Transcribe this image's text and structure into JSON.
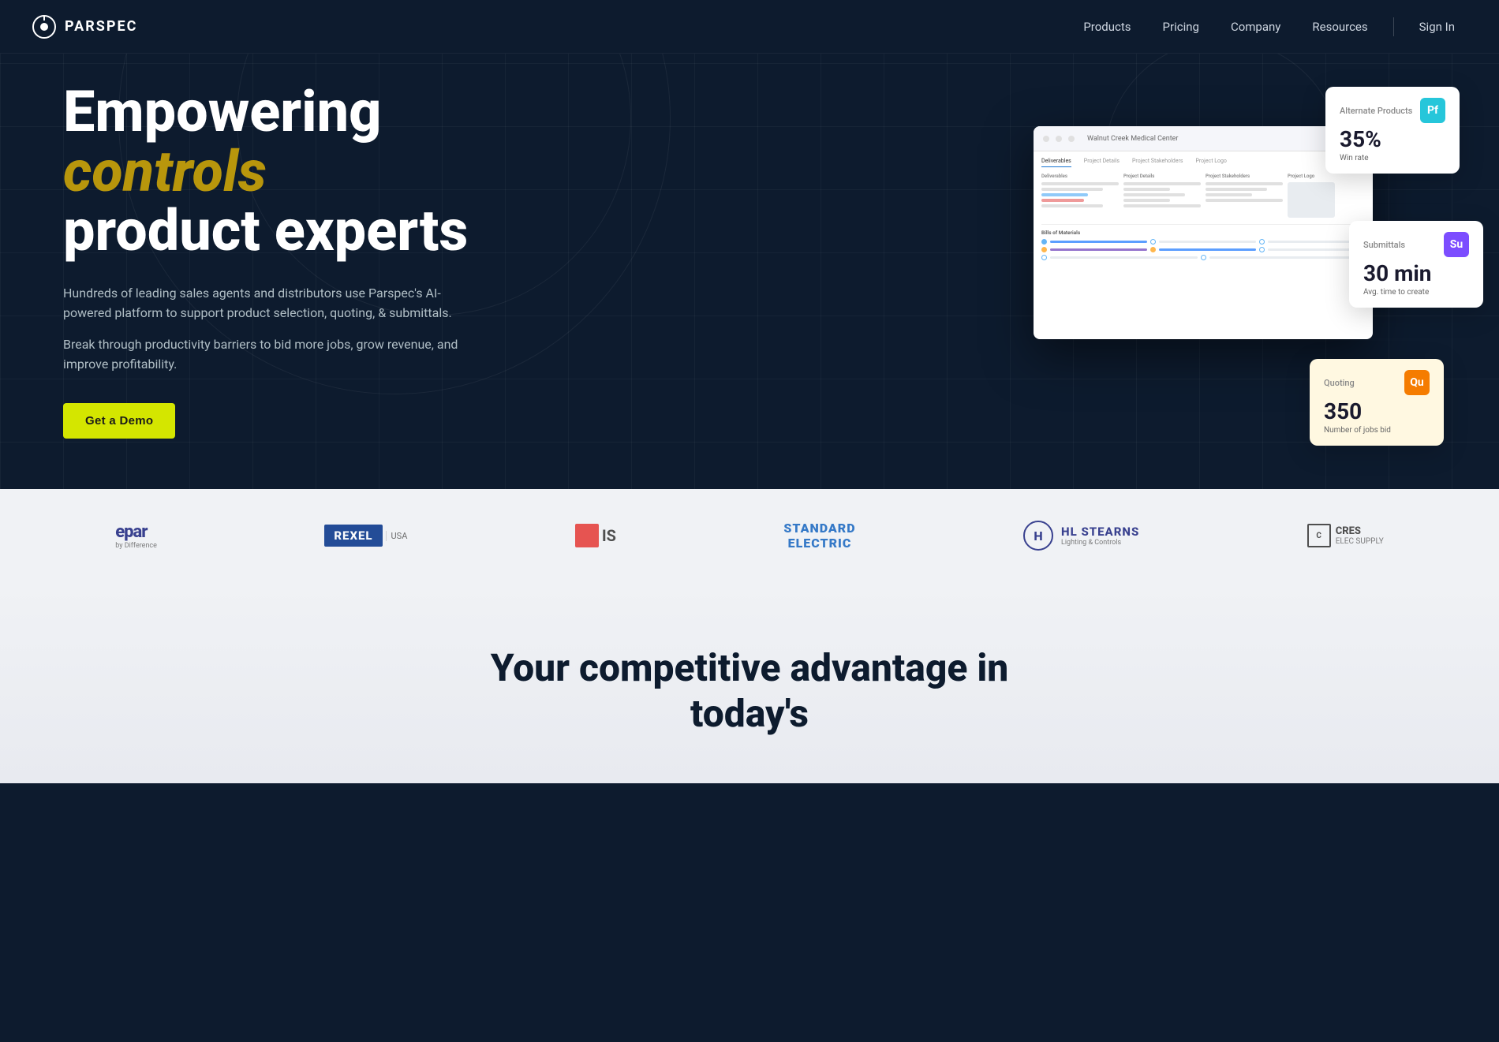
{
  "nav": {
    "logo_text": "PARSPEC",
    "links": [
      {
        "id": "products",
        "label": "Products"
      },
      {
        "id": "pricing",
        "label": "Pricing"
      },
      {
        "id": "company",
        "label": "Company"
      },
      {
        "id": "resources",
        "label": "Resources"
      }
    ],
    "signin_label": "Sign In"
  },
  "hero": {
    "title_line1": "Empowering",
    "title_highlight": "controls",
    "title_line2": "product experts",
    "desc1": "Hundreds of leading sales agents and distributors use Parspec's AI-powered platform to support product selection, quoting, & submittals.",
    "desc2": "Break through productivity barriers to bid more jobs, grow revenue, and improve profitability.",
    "cta_label": "Get a Demo"
  },
  "dashboard": {
    "project_name": "Walnut Creek Medical Center",
    "tabs": [
      "Deliverables",
      "Project Details",
      "Project Stakeholders",
      "Project Logo"
    ],
    "bom_label": "Bills of Materials"
  },
  "stat_cards": {
    "alternate_products": {
      "label": "Alternate Products",
      "value": "35%",
      "sub": "Win rate",
      "icon_text": "Pf",
      "icon_color": "#26c6da"
    },
    "submittals": {
      "label": "Submittals",
      "value": "30 min",
      "sub": "Avg. time to create",
      "icon_text": "Su",
      "icon_color": "#7c4dff"
    },
    "quoting": {
      "label": "Quoting",
      "value": "350",
      "sub": "Number of jobs bid",
      "icon_text": "Qu",
      "icon_color": "#f57c00"
    }
  },
  "logo_strip": {
    "logos": [
      {
        "id": "epar",
        "text": "epar",
        "subtext": "by Difference"
      },
      {
        "id": "rexel",
        "text": "REXEL",
        "subtext": "| USA"
      },
      {
        "id": "is",
        "text": "IS"
      },
      {
        "id": "standard",
        "text": "STANDARD ELECTRIC"
      },
      {
        "id": "hl-stearns",
        "text": "HL STEARNS",
        "subtext": "Lighting & Controls"
      },
      {
        "id": "cres",
        "text": "CRES ELEC SUPPLY"
      }
    ]
  },
  "bottom": {
    "title": "Your competitive advantage in today's"
  },
  "colors": {
    "hero_bg": "#0d1b2e",
    "accent_yellow": "#d4e600",
    "accent_gold": "#b8960c",
    "logo_strip_bg": "#f0f2f5"
  }
}
